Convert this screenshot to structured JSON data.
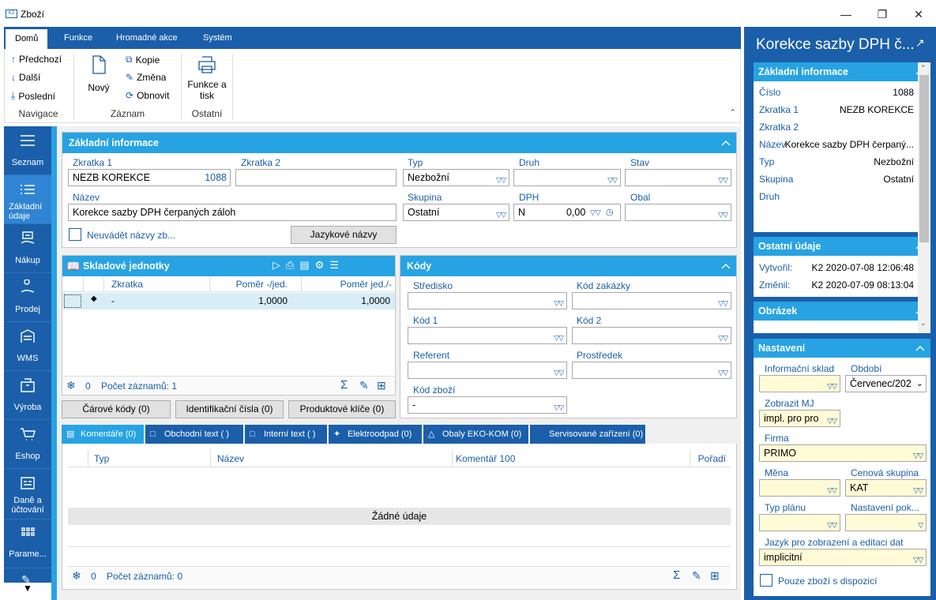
{
  "window": {
    "title": "Zboží",
    "app_badge": "K2"
  },
  "ribbon": {
    "tabs": [
      "Domů",
      "Funkce",
      "Hromadné akce",
      "Systém"
    ],
    "nav": {
      "prev": "Předchozí",
      "next": "Další",
      "last": "Poslední",
      "group": "Navigace"
    },
    "record": {
      "new": "Nový",
      "copy": "Kopie",
      "change": "Změna",
      "refresh": "Obnovit",
      "group": "Záznam"
    },
    "other": {
      "print": "Funkce a tisk",
      "group": "Ostatní"
    }
  },
  "leftnav": [
    "Seznam",
    "Základní údaje",
    "Nákup",
    "Prodej",
    "WMS",
    "Výroba",
    "Eshop",
    "Daně a účtování",
    "Parame..."
  ],
  "basic": {
    "header": "Základní informace",
    "zkratka1_label": "Zkratka 1",
    "zkratka1": "NEZB KOREKCE",
    "zkratka1_num": "1088",
    "zkratka2_label": "Zkratka 2",
    "zkratka2": "",
    "typ_label": "Typ",
    "typ": "Nezbožní",
    "druh_label": "Druh",
    "druh": "",
    "stav_label": "Stav",
    "stav": "",
    "nazev_label": "Název",
    "nazev": "Korekce sazby DPH čerpaných záloh",
    "skupina_label": "Skupina",
    "skupina": "Ostatní",
    "dph_label": "DPH",
    "dph_code": "N",
    "dph_value": "0,00",
    "obal_label": "Obal",
    "obal": "",
    "checkbox_label": "Neuvádět názvy zb...",
    "lang_button": "Jazykové názvy"
  },
  "units": {
    "header": "Skladové jednotky",
    "columns": [
      "Zkratka",
      "Poměr -/jed.",
      "Poměr jed./-"
    ],
    "rows": [
      {
        "zkratka": "-",
        "pomer1": "1,0000",
        "pomer2": "1,0000"
      }
    ],
    "count_zero": "0",
    "count_label": "Počet záznamů: 1"
  },
  "buttons": {
    "barcodes": "Čárové kódy (0)",
    "idnums": "Identifikační čísla (0)",
    "prodkeys": "Produktové klíče (0)"
  },
  "codes": {
    "header": "Kódy",
    "stredisko": "Středisko",
    "kod_zakazky": "Kód zakázky",
    "kod1": "Kód 1",
    "kod2": "Kód 2",
    "referent": "Referent",
    "prostredek": "Prostředek",
    "kod_zbozi": "Kód zboží",
    "kod_zbozi_value": "-"
  },
  "subtabs": [
    "Komentáře (0)",
    "Obchodní text ( )",
    "Interní text ( )",
    "Elektroodpad (0)",
    "Obaly EKO-KOM (0)",
    "Servisované zařízení (0)"
  ],
  "comments": {
    "columns": [
      "Typ",
      "Název",
      "Komentář 100",
      "Pořadí"
    ],
    "empty": "Žádné údaje",
    "count_zero": "0",
    "count_label": "Počet záznamů: 0"
  },
  "right": {
    "title": "Korekce sazby DPH č...",
    "basic_header": "Základní informace",
    "basic": [
      {
        "k": "Číslo",
        "v": "1088"
      },
      {
        "k": "Zkratka 1",
        "v": "NEZB KOREKCE"
      },
      {
        "k": "Zkratka 2",
        "v": ""
      },
      {
        "k": "Název",
        "v": "Korekce sazby DPH čerpaný..."
      },
      {
        "k": "Typ",
        "v": "Nezbožní"
      },
      {
        "k": "Skupina",
        "v": "Ostatní"
      },
      {
        "k": "Druh",
        "v": ""
      }
    ],
    "other_header": "Ostatní údaje",
    "created_label": "Vytvořil:",
    "created": "K2 2020-07-08 12:06:48",
    "changed_label": "Změnil:",
    "changed": "K2 2020-07-09 08:13:04",
    "image_header": "Obrázek",
    "settings_header": "Nastavení",
    "settings": {
      "sklad_label": "Informační sklad",
      "sklad": "",
      "obdobi_label": "Období",
      "obdobi": "Červenec/202",
      "mj_label": "Zobrazit MJ",
      "mj": "impl. pro pro",
      "firma_label": "Firma",
      "firma": "PRIMO",
      "mena_label": "Měna",
      "mena": "",
      "cen_label": "Cenová skupina",
      "cen": "KAT",
      "typplan_label": "Typ plánu",
      "typplan": "",
      "naspok_label": "Nastavení pok...",
      "naspok": "",
      "jazyk_label": "Jazyk pro zobrazení a editaci dat",
      "jazyk": "implicitní",
      "dispo_label": "Pouze zboží s dispozicí"
    }
  }
}
